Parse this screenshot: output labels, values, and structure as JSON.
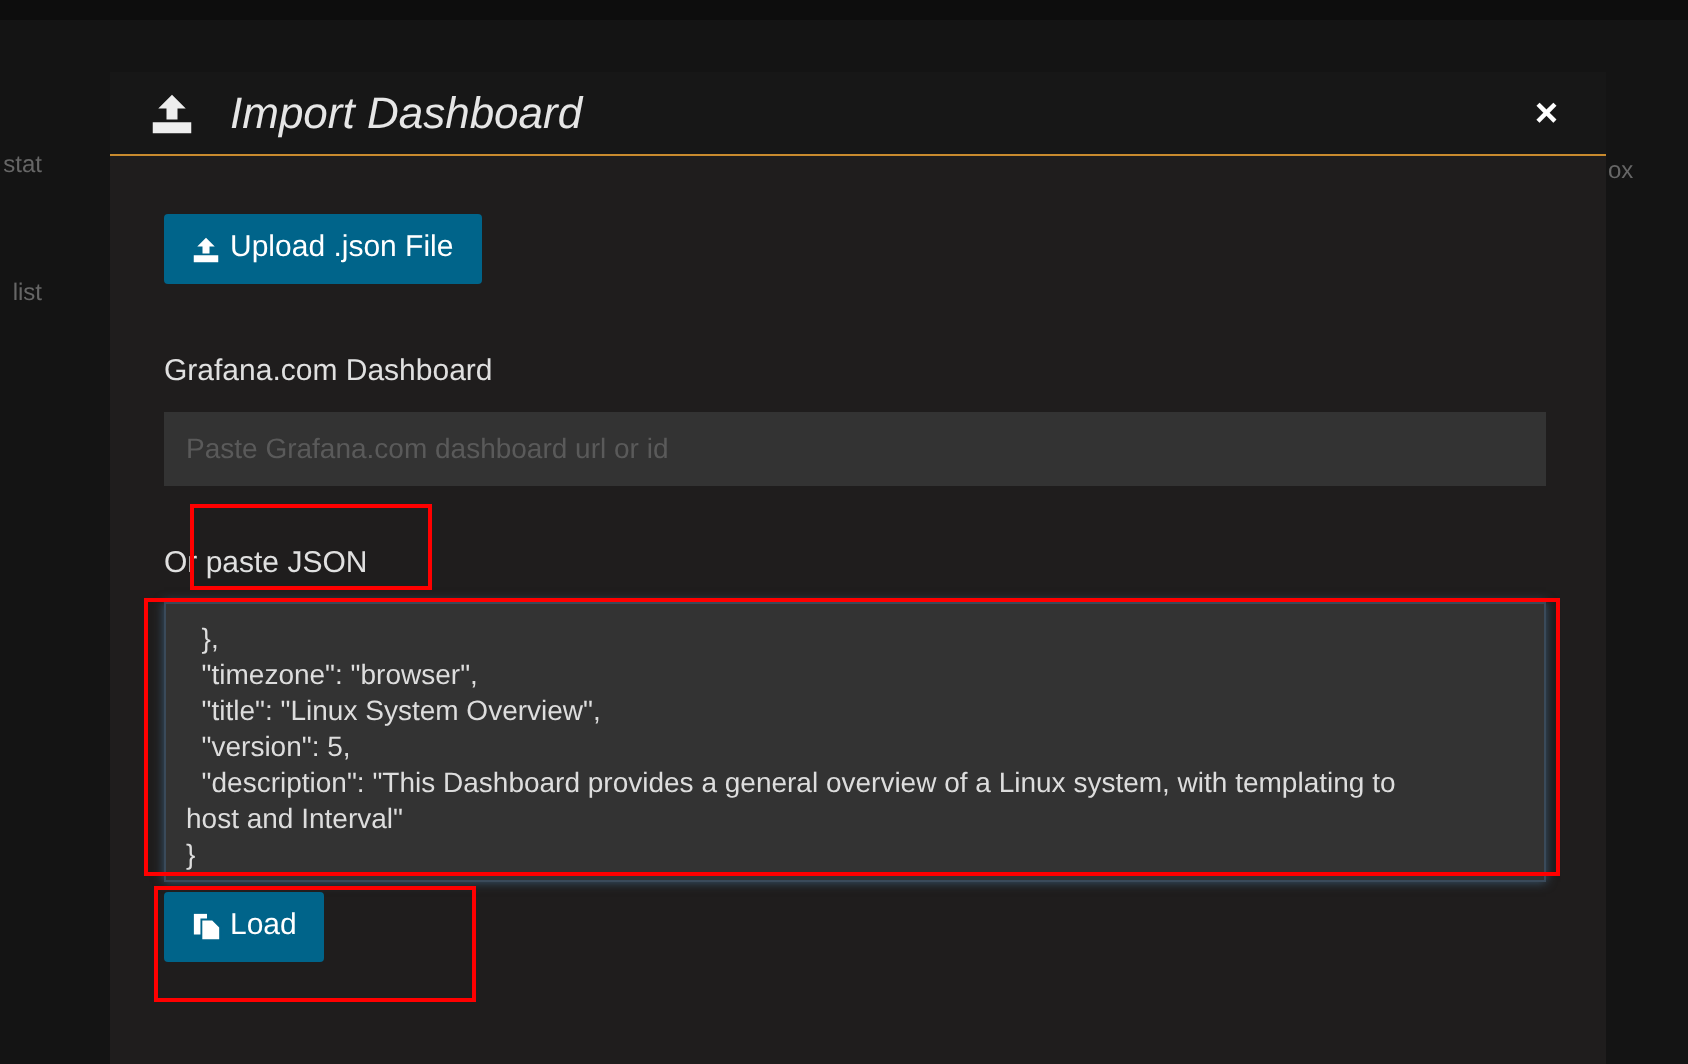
{
  "background": {
    "left_labels": [
      "stat",
      "list"
    ],
    "right_labels": [
      "ox"
    ]
  },
  "modal": {
    "title": "Import Dashboard",
    "close": "×",
    "upload_button": "Upload .json File",
    "grafana_label": "Grafana.com Dashboard",
    "grafana_field": {
      "placeholder": "Paste Grafana.com dashboard url or id"
    },
    "json_label": "Or paste JSON",
    "json_lines": [
      "  },",
      "  \"timezone\": \"browser\",",
      "  \"title\": \"Linux System Overview\",",
      "  \"version\": 5,",
      "  \"description\": \"This Dashboard provides a general overview of a Linux system, with templating to",
      "host and Interval\"",
      "}"
    ],
    "load_button": "Load"
  },
  "annotations": [
    {
      "kind": "highlight"
    },
    {
      "kind": "highlight"
    },
    {
      "kind": "highlight"
    }
  ]
}
